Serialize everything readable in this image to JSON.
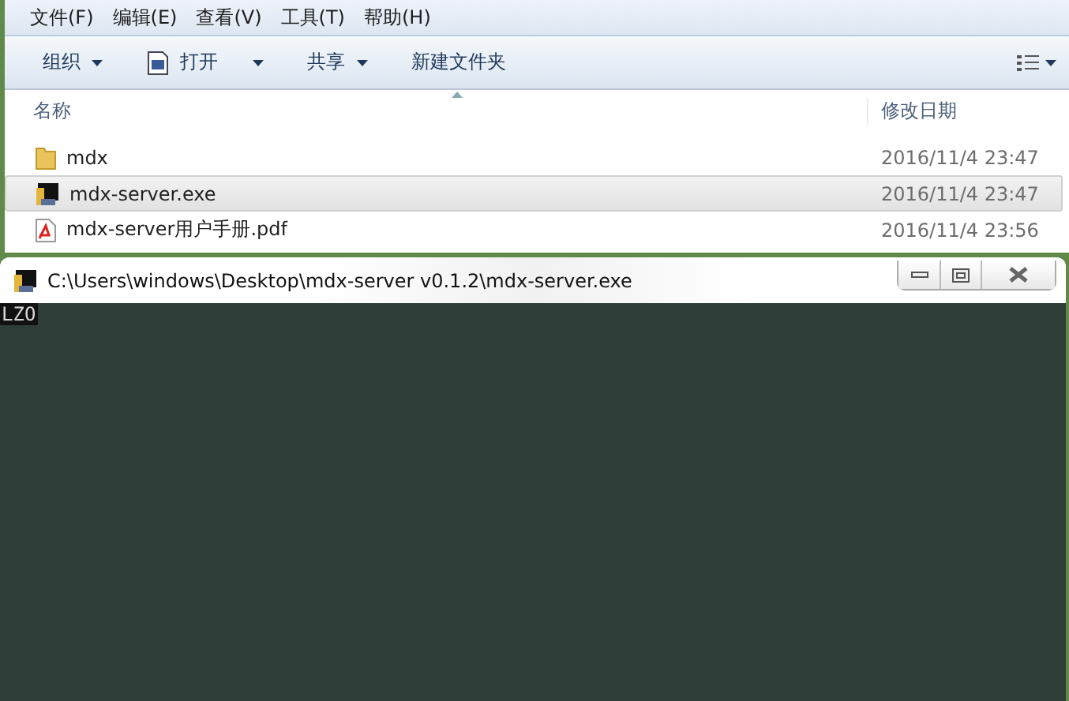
{
  "explorer": {
    "menu": [
      "文件(F)",
      "编辑(E)",
      "查看(V)",
      "工具(T)",
      "帮助(H)"
    ],
    "toolbar": [
      {
        "label": "组织",
        "kind": "dropdown"
      },
      {
        "label": "打开",
        "kind": "open"
      },
      {
        "label": "共享",
        "kind": "dropdown"
      },
      {
        "label": "新建文件夹",
        "kind": "plain"
      }
    ],
    "columns": [
      "名称",
      "修改日期"
    ],
    "files": [
      {
        "name": "mdx",
        "modified": "2016/11/4 23:47",
        "kind": "folder",
        "selected": false
      },
      {
        "name": "mdx-server.exe",
        "modified": "2016/11/4 23:47",
        "kind": "exe",
        "selected": true
      },
      {
        "name": "mdx-server用户手册.pdf",
        "modified": "2016/11/4 23:56",
        "kind": "pdf",
        "selected": false
      }
    ]
  },
  "console": {
    "title": "C:\\Users\\windows\\Desktop\\mdx-server v0.1.2\\mdx-server.exe",
    "output": "LZO"
  }
}
